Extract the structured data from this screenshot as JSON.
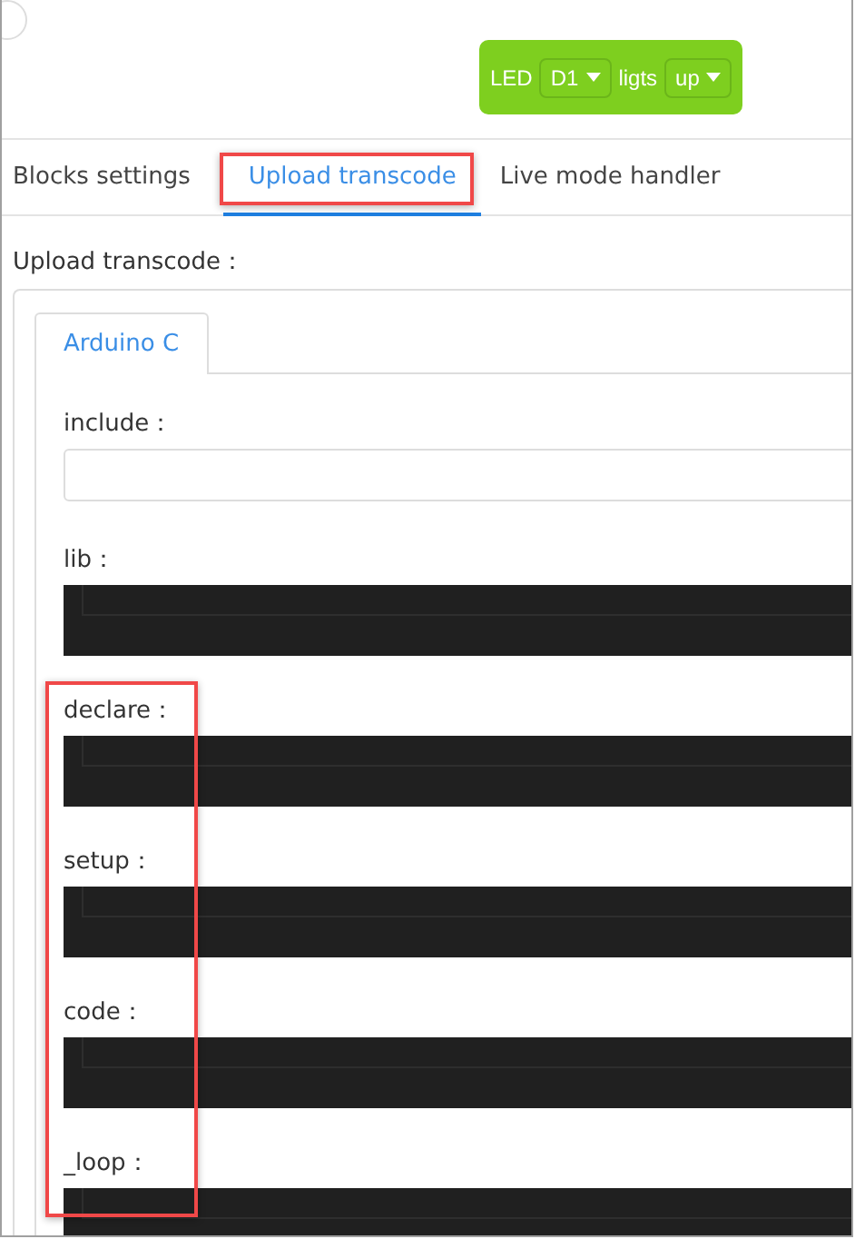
{
  "block": {
    "label": "LED",
    "dropdowns": [
      {
        "value": "D1"
      },
      {
        "value": "up"
      }
    ],
    "middle": "ligts"
  },
  "tabs": [
    {
      "label": "Blocks settings",
      "selected": false
    },
    {
      "label": "Upload transcode",
      "selected": true
    },
    {
      "label": "Live mode handler",
      "selected": false
    }
  ],
  "section_title": "Upload transcode：",
  "inner_tabs": [
    {
      "label": "Arduino C",
      "selected": true
    }
  ],
  "fields": [
    {
      "label": "include：",
      "kind": "input"
    },
    {
      "label": "lib：",
      "kind": "editor"
    },
    {
      "label": "declare：",
      "kind": "editor"
    },
    {
      "label": "setup：",
      "kind": "editor"
    },
    {
      "label": "code：",
      "kind": "editor"
    },
    {
      "label": "_loop：",
      "kind": "editor"
    }
  ]
}
